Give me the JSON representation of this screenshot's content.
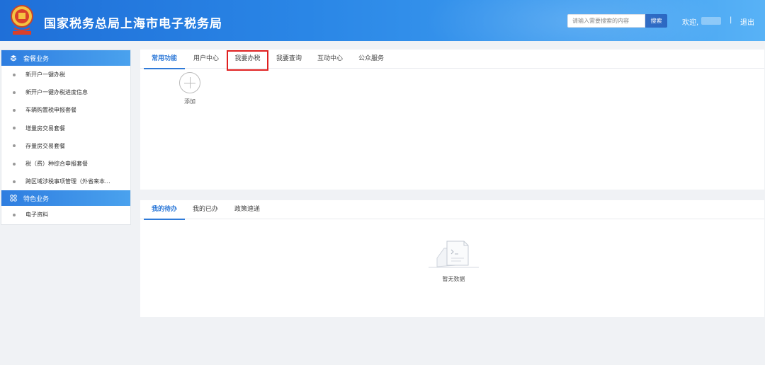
{
  "header": {
    "title": "国家税务总局上海市电子税务局",
    "search_placeholder": "请输入需要搜索的内容",
    "search_button": "搜索",
    "welcome": "欢迎,",
    "separator": "|",
    "logout": "退出"
  },
  "sidebar": {
    "groups": [
      {
        "title": "套餐业务",
        "icon": "layers-icon",
        "items": [
          "新开户一键办税",
          "新开户一键办税进度信息",
          "车辆购置税申报套餐",
          "增量房交易套餐",
          "存量房交易套餐",
          "税（费）种综合申报套餐",
          "跨区域涉税事项管理（外省来本..."
        ]
      },
      {
        "title": "特色业务",
        "icon": "grid-icon",
        "items": [
          "电子资料"
        ]
      }
    ]
  },
  "top_panel": {
    "tabs": [
      "常用功能",
      "用户中心",
      "我要办税",
      "我要查询",
      "互动中心",
      "公众服务"
    ],
    "active_tab": "常用功能",
    "highlighted_tab": "我要办税",
    "add_label": "添加"
  },
  "bottom_panel": {
    "tabs": [
      "我的待办",
      "我的已办",
      "政策速递"
    ],
    "active_tab": "我的待办",
    "empty_text": "暂无数据"
  },
  "colors": {
    "accent": "#2f7ad8",
    "header_start": "#1f6fd8",
    "header_end": "#58b2f6",
    "highlight": "#e02020"
  }
}
